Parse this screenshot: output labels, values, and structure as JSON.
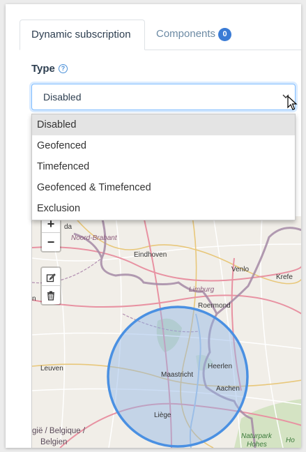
{
  "tabs": {
    "dynamic_label": "Dynamic subscription",
    "components_label": "Components",
    "components_count": "0"
  },
  "type": {
    "label": "Type",
    "help_icon": "question-circle-icon",
    "selected": "Disabled",
    "options": [
      "Disabled",
      "Geofenced",
      "Timefenced",
      "Geofenced & Timefenced",
      "Exclusion"
    ]
  },
  "map": {
    "zoom_in": "+",
    "zoom_out": "−",
    "labels": {
      "noord_brabant": "Noord-Brabant",
      "eindhoven": "Eindhoven",
      "venlo": "Venlo",
      "krefe": "Krefe",
      "limburg": "Limburg",
      "roermond": "Roermond",
      "heerlen": "Heerlen",
      "maastricht": "Maastricht",
      "aachen": "Aachen",
      "leuven": "Leuven",
      "liege": "Liège",
      "belgie": "gië / Belgique /",
      "belgien": "Belgien",
      "naturpark": "Naturpark",
      "hohes": "Hohes",
      "ho": "Ho",
      "n_edge": "n",
      "da": "da"
    }
  },
  "colors": {
    "accent": "#3a7bd5",
    "circle_fill": "#8fb4e6",
    "circle_stroke": "#4a90e2"
  }
}
